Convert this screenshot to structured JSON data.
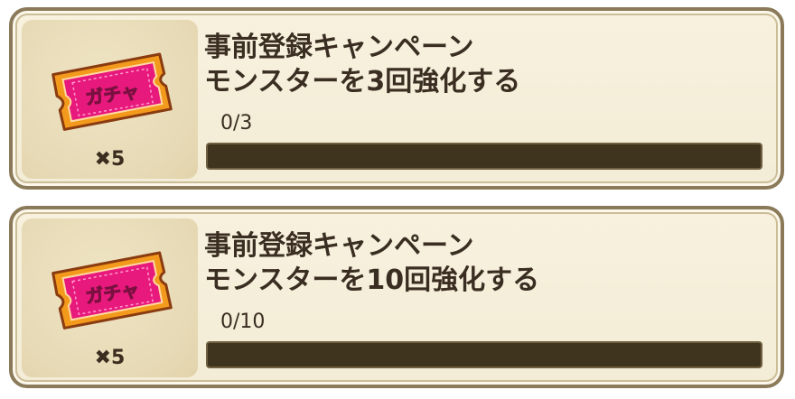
{
  "missions": [
    {
      "title_line1": "事前登録キャンペーン",
      "title_line2": "モンスターを3回強化する",
      "progress_label": "0/3",
      "progress_current": 0,
      "progress_total": 3,
      "reward": {
        "icon": "gacha-ticket-icon",
        "ticket_label": "ガチャ",
        "quantity_label": "✖5"
      }
    },
    {
      "title_line1": "事前登録キャンペーン",
      "title_line2": "モンスターを10回強化する",
      "progress_label": "0/10",
      "progress_current": 0,
      "progress_total": 10,
      "reward": {
        "icon": "gacha-ticket-icon",
        "ticket_label": "ガチャ",
        "quantity_label": "✖5"
      }
    }
  ],
  "colors": {
    "card_bg": "#f3ecd6",
    "card_border": "#8a7a59",
    "text": "#3a2d21",
    "bar_track": "#3f341d",
    "ticket_pink": "#e8197c",
    "ticket_orange": "#f39a1d"
  }
}
